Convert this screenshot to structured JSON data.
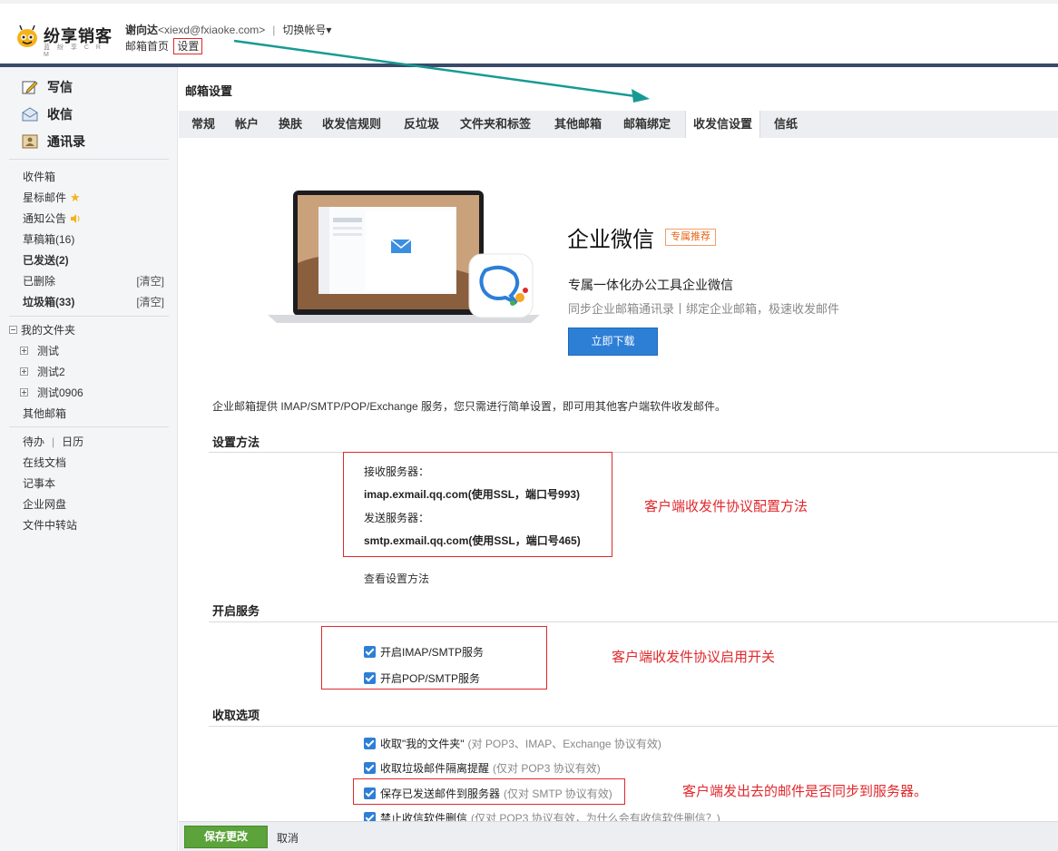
{
  "header": {
    "logo_text": "纷享销客",
    "logo_sub": "蓝 纷 享 C R M",
    "user_name": "谢向达",
    "user_email": "<xiexd@fxiaoke.com>",
    "separator": "|",
    "switch_account": "切换帐号",
    "nav_home": "邮箱首页",
    "nav_settings": "设置"
  },
  "sidebar": {
    "compose": "写信",
    "inbox_big": "收信",
    "contacts": "通讯录",
    "inbox": "收件箱",
    "starred": "星标邮件",
    "notice": "通知公告",
    "drafts": "草稿箱(16)",
    "sent": "已发送(2)",
    "deleted": "已删除",
    "deleted_clear": "[清空]",
    "spam": "垃圾箱(33)",
    "spam_clear": "[清空]",
    "my_folders": "我的文件夹",
    "folders": [
      "测试",
      "测试2",
      "测试0906"
    ],
    "other_mailbox": "其他邮箱",
    "todo": "待办",
    "todo_sep": "|",
    "calendar": "日历",
    "docs": "在线文档",
    "notes": "记事本",
    "disk": "企业网盘",
    "transfer": "文件中转站"
  },
  "main": {
    "title": "邮箱设置",
    "tabs": [
      "常规",
      "帐户",
      "换肤",
      "收发信规则",
      "反垃圾",
      "文件夹和标签",
      "其他邮箱",
      "邮箱绑定",
      "收发信设置",
      "信纸"
    ],
    "active_tab": "收发信设置"
  },
  "promo": {
    "title": "企业微信",
    "badge": "专属推荐",
    "subtitle": "专属一体化办公工具企业微信",
    "desc": "同步企业邮箱通讯录丨绑定企业邮箱，极速收发邮件",
    "button": "立即下载"
  },
  "intro": "企业邮箱提供 IMAP/SMTP/POP/Exchange 服务，您只需进行简单设置，即可用其他客户端软件收发邮件。",
  "setup": {
    "title": "设置方法",
    "recv_label": "接收服务器：",
    "recv_value": "imap.exmail.qq.com(使用SSL，端口号993)",
    "send_label": "发送服务器：",
    "send_value": "smtp.exmail.qq.com(使用SSL，端口号465)",
    "view_link": "查看设置方法",
    "note": "客户端收发件协议配置方法"
  },
  "services": {
    "title": "开启服务",
    "imap": "开启IMAP/SMTP服务",
    "pop": "开启POP/SMTP服务",
    "note": "客户端收发件协议启用开关"
  },
  "fetch": {
    "title": "收取选项",
    "opt1": "收取\"我的文件夹\"",
    "opt1_hint": "(对 POP3、IMAP、Exchange 协议有效)",
    "opt2": "收取垃圾邮件隔离提醒",
    "opt2_hint": "(仅对 POP3 协议有效)",
    "opt3": "保存已发送邮件到服务器",
    "opt3_hint": "(仅对 SMTP 协议有效)",
    "opt4": "禁止收信软件删信",
    "opt4_hint": "(仅对 POP3 协议有效，为什么会有收信软件删信？)",
    "note": "客户端发出去的邮件是否同步到服务器。"
  },
  "footer": {
    "save": "保存更改",
    "cancel": "取消"
  },
  "colors": {
    "accent_blue": "#2d7fd6",
    "annotation_red": "#e0282c",
    "arrow_teal": "#179a94",
    "save_green": "#5ba33a"
  }
}
